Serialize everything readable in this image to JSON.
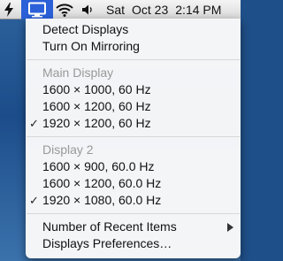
{
  "menubar": {
    "icons": [
      "script-bolt-icon",
      "display-icon",
      "wifi-icon",
      "volume-icon"
    ],
    "day": "Sat",
    "date": "Oct 23",
    "time": "2:14 PM",
    "active_icon_color": "#2b60d8"
  },
  "menu": {
    "actions": {
      "detect_displays": "Detect Displays",
      "turn_on_mirroring": "Turn On Mirroring"
    },
    "main_display": {
      "header": "Main Display",
      "modes": [
        {
          "label": "1600 × 1000, 60 Hz",
          "checked": false
        },
        {
          "label": "1600 × 1200, 60 Hz",
          "checked": false
        },
        {
          "label": "1920 × 1200, 60 Hz",
          "checked": true
        }
      ]
    },
    "display_2": {
      "header": "Display 2",
      "modes": [
        {
          "label": "1600 × 900, 60.0 Hz",
          "checked": false
        },
        {
          "label": "1600 × 1200, 60.0 Hz",
          "checked": false
        },
        {
          "label": "1920 × 1080, 60.0 Hz",
          "checked": true
        }
      ]
    },
    "footer": {
      "recent_items": "Number of Recent Items",
      "preferences": "Displays Preferences…"
    },
    "check_mark": "✓"
  }
}
